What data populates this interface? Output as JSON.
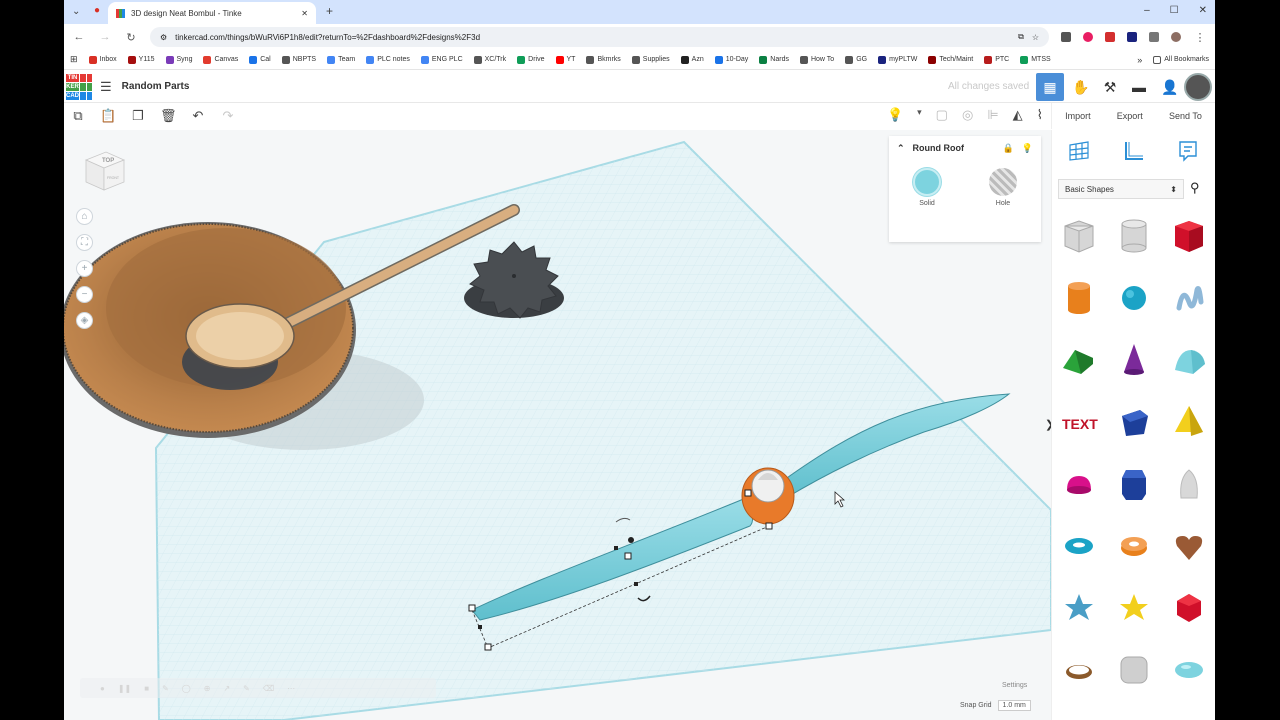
{
  "browser": {
    "tab_title": "3D design Neat Bombul - Tinke",
    "url": "tinkercad.com/things/bWuRVi6P1h8/edit?returnTo=%2Fdashboard%2Fdesigns%2F3d",
    "new_tab_symbol": "+",
    "window_controls": [
      "–",
      "☐",
      "✕"
    ],
    "bookmarks": [
      {
        "label": "Inbox",
        "color": "#d93025"
      },
      {
        "label": "Y115",
        "color": "#a50e0e"
      },
      {
        "label": "Syng",
        "color": "#7a3bb8"
      },
      {
        "label": "Canvas",
        "color": "#e23b2e"
      },
      {
        "label": "Cal",
        "color": "#1a73e8"
      },
      {
        "label": "NBPTS",
        "color": "#555555"
      },
      {
        "label": "Team",
        "color": "#4285f4"
      },
      {
        "label": "PLC notes",
        "color": "#4285f4"
      },
      {
        "label": "ENG PLC",
        "color": "#4285f4"
      },
      {
        "label": "XC/Trk",
        "color": "#555555"
      },
      {
        "label": "Drive",
        "color": "#0f9d58"
      },
      {
        "label": "YT",
        "color": "#ff0000"
      },
      {
        "label": "Bkmrks",
        "color": "#555555"
      },
      {
        "label": "Supplies",
        "color": "#555555"
      },
      {
        "label": "Azn",
        "color": "#222222"
      },
      {
        "label": "10-Day",
        "color": "#1a73e8"
      },
      {
        "label": "Nards",
        "color": "#0b8043"
      },
      {
        "label": "How To",
        "color": "#555555"
      },
      {
        "label": "GG",
        "color": "#555555"
      },
      {
        "label": "myPLTW",
        "color": "#1a237e"
      },
      {
        "label": "Tech/Maint",
        "color": "#8b0000"
      },
      {
        "label": "PTC",
        "color": "#b71c1c"
      },
      {
        "label": "MTSS",
        "color": "#0f9d58"
      }
    ],
    "bookmarks_overflow": "»",
    "all_bookmarks": "All Bookmarks"
  },
  "app": {
    "logo_letters": [
      "TIN",
      "KER",
      "CAD"
    ],
    "design_name": "Random Parts",
    "save_status": "All changes saved"
  },
  "panel_actions": {
    "import": "Import",
    "export": "Export",
    "send_to": "Send To"
  },
  "inspector": {
    "shape_name": "Round Roof",
    "solid_label": "Solid",
    "hole_label": "Hole"
  },
  "viewcube": {
    "top": "TOP",
    "front": "FRONT"
  },
  "workplane": {
    "settings": "Settings",
    "snap_grid_label": "Snap Grid",
    "snap_grid_value": "1.0 mm",
    "collapse_symbol": "❯"
  },
  "shapes_panel": {
    "category": "Basic Shapes",
    "category_chevron": "⬍",
    "shapes": [
      {
        "name": "box-hole",
        "color": "#c8c8c8"
      },
      {
        "name": "cylinder-hole",
        "color": "#c8c8c8"
      },
      {
        "name": "box",
        "color": "#d0102a"
      },
      {
        "name": "cylinder",
        "color": "#e8801c"
      },
      {
        "name": "sphere",
        "color": "#1ba3c6"
      },
      {
        "name": "scribble",
        "color": "#8fb8d8"
      },
      {
        "name": "roof",
        "color": "#2aa33a"
      },
      {
        "name": "cone",
        "color": "#7b2a9a"
      },
      {
        "name": "round-roof",
        "color": "#7dd3df"
      },
      {
        "name": "text",
        "color": "#c0132a"
      },
      {
        "name": "shape-generator",
        "color": "#1d3f9a"
      },
      {
        "name": "pyramid",
        "color": "#f2cf1d"
      },
      {
        "name": "half-sphere",
        "color": "#d8108a"
      },
      {
        "name": "polygon",
        "color": "#1d3f9a"
      },
      {
        "name": "paraboloid",
        "color": "#d8d8d8"
      },
      {
        "name": "torus",
        "color": "#1ba3c6"
      },
      {
        "name": "tube",
        "color": "#e8801c"
      },
      {
        "name": "heart",
        "color": "#9a5a35"
      },
      {
        "name": "star",
        "color": "#4a9ec6"
      },
      {
        "name": "star-yellow",
        "color": "#f2cf1d"
      },
      {
        "name": "icosahedron",
        "color": "#d0102a"
      },
      {
        "name": "ring",
        "color": "#8b5a2b"
      },
      {
        "name": "rounded-box",
        "color": "#cfcfcf"
      },
      {
        "name": "ellipsoid",
        "color": "#7dd3df"
      }
    ]
  },
  "colors": {
    "accent": "#4a8ed8",
    "workplane_grid": "#bfe6ee",
    "selected_shape": "#7dd3df"
  }
}
